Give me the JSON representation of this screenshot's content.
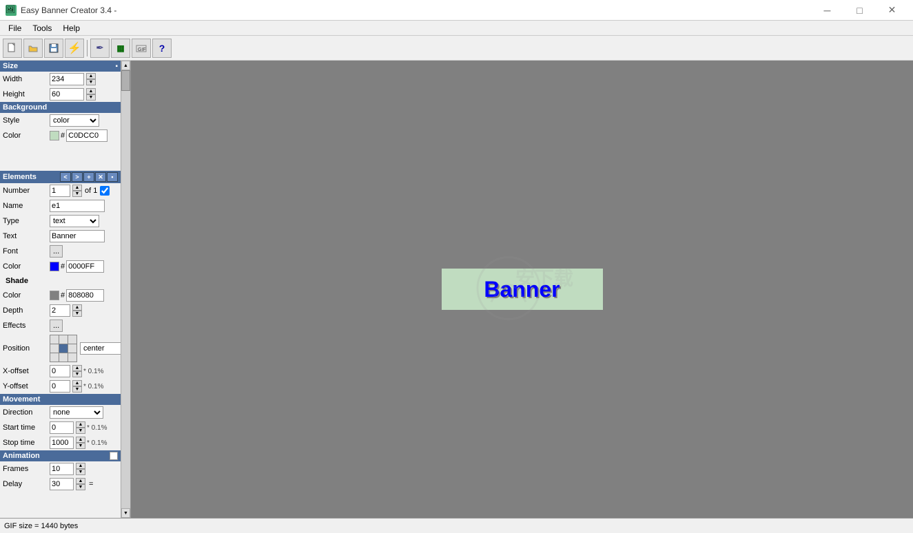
{
  "titlebar": {
    "icon": "🖼",
    "title": "Easy Banner Creator 3.4 -",
    "minimize": "─",
    "maximize": "□",
    "close": "✕"
  },
  "menubar": {
    "items": [
      "File",
      "Tools",
      "Help"
    ]
  },
  "toolbar": {
    "buttons": [
      "new",
      "open",
      "save",
      "flash",
      "edit",
      "preview",
      "export",
      "help"
    ]
  },
  "leftpanel": {
    "size_section": "Size",
    "width_label": "Width",
    "width_value": "234",
    "height_label": "Height",
    "height_value": "60",
    "background_section": "Background",
    "style_label": "Style",
    "style_value": "color",
    "color_label": "Color",
    "color_hex": "C0DCC0",
    "color_swatch": "#C0DCC0",
    "elements_section": "Elements",
    "number_label": "Number",
    "number_value": "1",
    "of_label": "of 1",
    "name_label": "Name",
    "name_value": "e1",
    "type_label": "Type",
    "type_value": "text",
    "text_label": "Text",
    "text_value": "Banner",
    "font_label": "Font",
    "font_value": "...",
    "color2_label": "Color",
    "color2_hex": "0000FF",
    "color2_swatch": "#0000FF",
    "shade_label": "Shade",
    "shade_color_hex": "808080",
    "shade_color_swatch": "#808080",
    "depth_label": "Depth",
    "depth_value": "2",
    "effects_label": "Effects",
    "effects_btn": "...",
    "position_label": "Position",
    "position_value": "center",
    "xoffset_label": "X-offset",
    "xoffset_value": "0",
    "xoffset_pct": "* 0.1%",
    "yoffset_label": "Y-offset",
    "yoffset_value": "0",
    "yoffset_pct": "* 0.1%",
    "movement_section": "Movement",
    "direction_label": "Direction",
    "direction_value": "none",
    "starttime_label": "Start time",
    "starttime_value": "0",
    "starttime_pct": "* 0.1%",
    "stoptime_label": "Stop time",
    "stoptime_value": "1000",
    "stoptime_pct": "* 0.1%",
    "animation_section": "Animation",
    "frames_label": "Frames",
    "frames_value": "10",
    "delay_label": "Delay",
    "delay_value": "30",
    "delay_eq": "="
  },
  "canvas": {
    "banner_text": "Banner",
    "banner_bg": "#C0DCC0",
    "banner_width": 234,
    "banner_height": 60
  },
  "statusbar": {
    "text": "GIF size = 1440 bytes"
  }
}
